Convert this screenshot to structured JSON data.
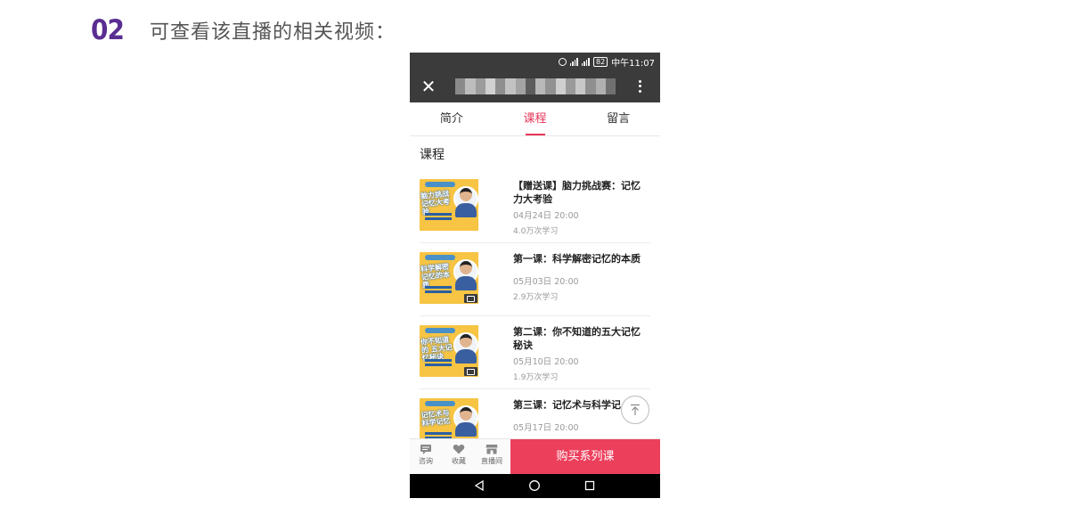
{
  "header": {
    "step": "02",
    "title": "可查看该直播的相关视频："
  },
  "status_bar": {
    "time": "中午11:07",
    "battery": "82",
    "icons": [
      "alarm-icon",
      "signal-icon",
      "signal-icon",
      "battery-icon"
    ]
  },
  "app_bar": {
    "close_icon": "close-icon",
    "more_icon": "more-icon",
    "title_blurred": true
  },
  "tabs": [
    {
      "label": "简介",
      "active": false
    },
    {
      "label": "课程",
      "active": true
    },
    {
      "label": "留言",
      "active": false
    }
  ],
  "section_title": "课程",
  "courses": [
    {
      "title": "【赠送课】脑力挑战赛：记忆力大考验",
      "date": "04月24日 20:00",
      "count": "4.0万次学习",
      "thumb_slogan": "脑力挑战 记忆大考验",
      "has_video_icon": false
    },
    {
      "title": "第一课：科学解密记忆的本质",
      "date": "05月03日 20:00",
      "count": "2.9万次学习",
      "thumb_slogan": "科学解密 记忆的本质",
      "has_video_icon": true
    },
    {
      "title": "第二课：你不知道的五大记忆秘诀",
      "date": "05月10日 20:00",
      "count": "1.9万次学习",
      "thumb_slogan": "你不知道的 五大记忆秘诀",
      "has_video_icon": true
    },
    {
      "title": "第三课：记忆术与科学记",
      "date": "05月17日 20:00",
      "count": "",
      "thumb_slogan": "记忆术与 科学记忆",
      "has_video_icon": false
    }
  ],
  "bottom_bar": {
    "items": [
      {
        "label": "咨询",
        "icon": "chat-icon"
      },
      {
        "label": "收藏",
        "icon": "heart-icon"
      },
      {
        "label": "直播间",
        "icon": "store-icon"
      }
    ],
    "buy_label": "购买系列课",
    "accent": "#ec3f5c"
  },
  "colors": {
    "step_number": "#5a2e91",
    "tab_active": "#e8365a",
    "dark_bar": "#3b3b3b"
  }
}
